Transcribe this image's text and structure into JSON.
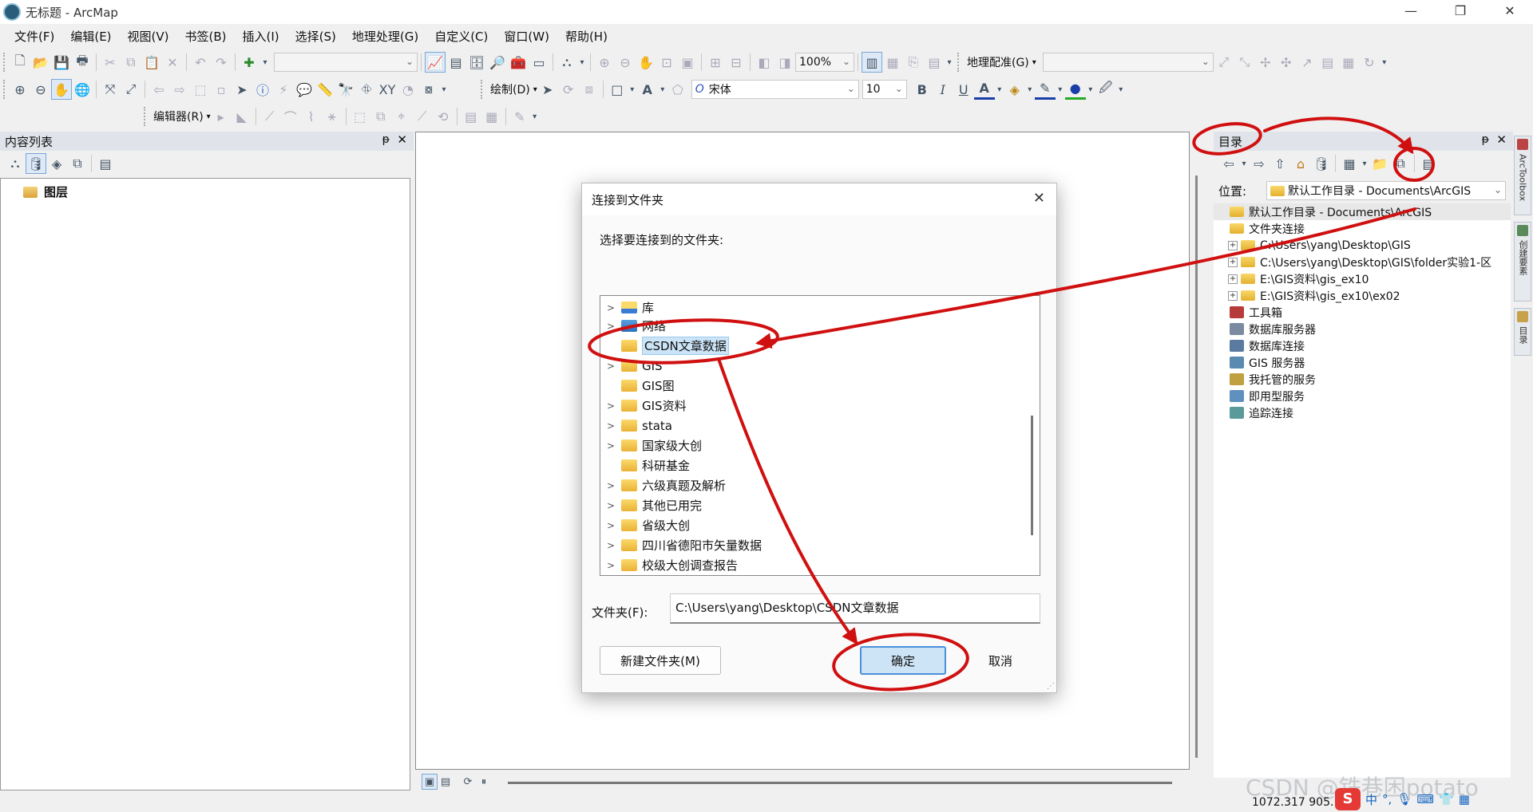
{
  "window": {
    "title": "无标题 - ArcMap",
    "minimize": "—",
    "restore": "❐",
    "close": "✕"
  },
  "menu": [
    "文件(F)",
    "编辑(E)",
    "视图(V)",
    "书签(B)",
    "插入(I)",
    "选择(S)",
    "地理处理(G)",
    "自定义(C)",
    "窗口(W)",
    "帮助(H)"
  ],
  "toolbar": {
    "scale_value": "",
    "zoom_value": "100%",
    "georef_label": "地理配准(G)",
    "draw_label": "绘制(D)",
    "font_name": "宋体",
    "font_size": "10",
    "editor_label": "编辑器(R)",
    "bold": "B",
    "italic": "I",
    "underline": "U",
    "text_a": "A"
  },
  "toc": {
    "title": "内容列表",
    "layer_root": "图层",
    "pin": "ᵽ",
    "close": "✕"
  },
  "catalog": {
    "title": "目录",
    "location_label": "位置:",
    "location_value": "默认工作目录 - Documents\\ArcGIS",
    "pin": "ᵽ",
    "close": "✕",
    "items": [
      {
        "label": "默认工作目录 - Documents\\ArcGIS",
        "level": 0,
        "expander": "",
        "icon": "home-folder"
      },
      {
        "label": "文件夹连接",
        "level": 0,
        "expander": "",
        "icon": "folder-connections"
      },
      {
        "label": "C:\\Users\\yang\\Desktop\\GIS",
        "level": 1,
        "expander": "+",
        "icon": "folder"
      },
      {
        "label": "C:\\Users\\yang\\Desktop\\GIS\\folder实验1-区",
        "level": 1,
        "expander": "+",
        "icon": "folder"
      },
      {
        "label": "E:\\GIS资料\\gis_ex10",
        "level": 1,
        "expander": "+",
        "icon": "folder"
      },
      {
        "label": "E:\\GIS资料\\gis_ex10\\ex02",
        "level": 1,
        "expander": "+",
        "icon": "folder"
      },
      {
        "label": "工具箱",
        "level": 0,
        "expander": "",
        "icon": "toolbox"
      },
      {
        "label": "数据库服务器",
        "level": 0,
        "expander": "",
        "icon": "db-server"
      },
      {
        "label": "数据库连接",
        "level": 0,
        "expander": "",
        "icon": "db-connection"
      },
      {
        "label": "GIS 服务器",
        "level": 0,
        "expander": "",
        "icon": "gis-server"
      },
      {
        "label": "我托管的服务",
        "level": 0,
        "expander": "",
        "icon": "hosted-services"
      },
      {
        "label": "即用型服务",
        "level": 0,
        "expander": "",
        "icon": "ready-services"
      },
      {
        "label": "追踪连接",
        "level": 0,
        "expander": "",
        "icon": "tracking"
      }
    ]
  },
  "side_tabs": [
    "ArcToolbox",
    "创建要素",
    "目录"
  ],
  "dialog": {
    "title": "连接到文件夹",
    "close": "✕",
    "prompt": "选择要连接到的文件夹:",
    "folders": [
      {
        "label": "库",
        "chevron": ">",
        "selected": false,
        "special": "library"
      },
      {
        "label": "网络",
        "chevron": ">",
        "selected": false,
        "special": "network"
      },
      {
        "label": "CSDN文章数据",
        "chevron": "",
        "selected": true
      },
      {
        "label": "GIS",
        "chevron": ">",
        "selected": false
      },
      {
        "label": "GIS图",
        "chevron": "",
        "selected": false
      },
      {
        "label": "GIS资料",
        "chevron": ">",
        "selected": false
      },
      {
        "label": "stata",
        "chevron": ">",
        "selected": false
      },
      {
        "label": "国家级大创",
        "chevron": ">",
        "selected": false
      },
      {
        "label": "科研基金",
        "chevron": "",
        "selected": false
      },
      {
        "label": "六级真题及解析",
        "chevron": ">",
        "selected": false
      },
      {
        "label": "其他已用完",
        "chevron": ">",
        "selected": false
      },
      {
        "label": "省级大创",
        "chevron": ">",
        "selected": false
      },
      {
        "label": "四川省德阳市矢量数据",
        "chevron": ">",
        "selected": false
      },
      {
        "label": "校级大创调查报告",
        "chevron": ">",
        "selected": false
      }
    ],
    "folder_label": "文件夹(F):",
    "folder_value": "C:\\Users\\yang\\Desktop\\CSDN文章数据",
    "new_folder_button": "新建文件夹(M)",
    "ok_button": "确定",
    "cancel_button": "取消"
  },
  "status": {
    "coords": "1072.317  905.",
    "watermark": "CSDN @铁巷困potato"
  },
  "tray": {
    "logo": "S",
    "ime": "中"
  },
  "colors": {
    "annotation": "#d01010",
    "selection": "#cce4f7",
    "panel_header": "#e0e4ea"
  }
}
